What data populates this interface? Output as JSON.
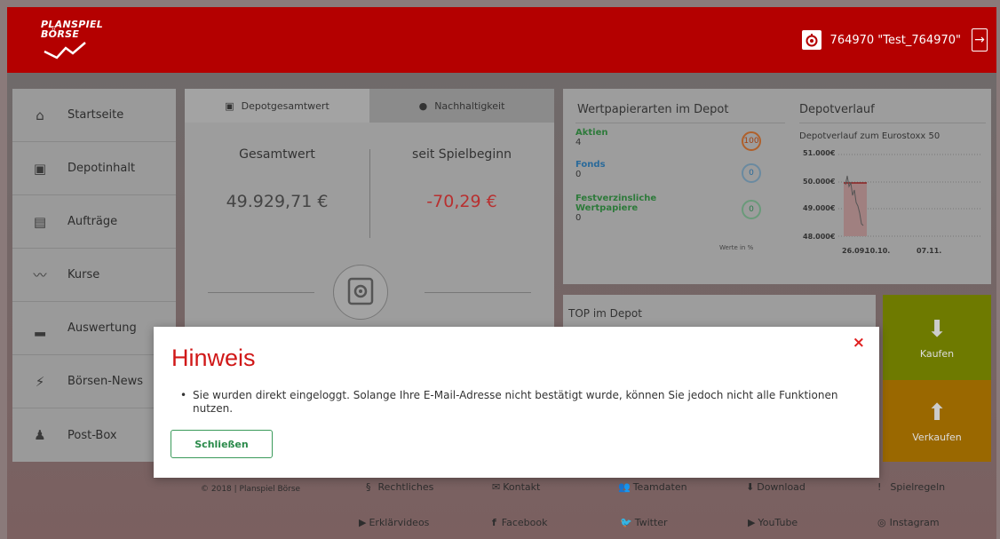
{
  "header": {
    "logo_line1": "PLANSPIEL",
    "logo_line2": "BÖRSE",
    "account": "764970 \"Test_764970\""
  },
  "sidebar": {
    "items": [
      {
        "label": "Startseite",
        "icon": "home-icon"
      },
      {
        "label": "Depotinhalt",
        "icon": "portfolio-icon"
      },
      {
        "label": "Aufträge",
        "icon": "orders-icon"
      },
      {
        "label": "Kurse",
        "icon": "prices-icon"
      },
      {
        "label": "Auswertung",
        "icon": "chart-icon"
      },
      {
        "label": "Börsen-News",
        "icon": "news-icon"
      },
      {
        "label": "Post-Box",
        "icon": "bell-icon"
      }
    ]
  },
  "depot": {
    "tab1": "Depotgesamtwert",
    "tab2": "Nachhaltigkeit",
    "col1_label": "Gesamtwert",
    "col1_value": "49.929,71 €",
    "col2_label": "seit Spielbeginn",
    "col2_value": "-70,29 €"
  },
  "wertpapiere": {
    "title": "Wertpapierarten im Depot",
    "rows": [
      {
        "name": "Aktien",
        "count": "4",
        "badge": "100"
      },
      {
        "name": "Fonds",
        "count": "0",
        "badge": "0"
      },
      {
        "name": "Festverzinsliche Wertpapiere",
        "count": "0",
        "badge": "0"
      }
    ],
    "note": "Werte in %"
  },
  "verlauf": {
    "title": "Depotverlauf",
    "subtitle": "Depotverlauf zum Eurostoxx 50",
    "y_ticks": [
      "51.000€",
      "50.000€",
      "49.000€",
      "48.000€"
    ],
    "x_ticks": [
      "26.09.",
      "10.10.",
      "07.11."
    ]
  },
  "top": {
    "title": "TOP im Depot"
  },
  "buttons": {
    "kaufen": "Kaufen",
    "verkaufen": "Verkaufen"
  },
  "footer": {
    "copyright": "© 2018 | Planspiel Börse",
    "rechtliches": "Rechtliches",
    "kontakt": "Kontakt",
    "teamdaten": "Teamdaten",
    "download": "Download",
    "spielregeln": "Spielregeln",
    "erklaervideos": "Erklärvideos",
    "facebook": "Facebook",
    "twitter": "Twitter",
    "youtube": "YouTube",
    "instagram": "Instagram"
  },
  "modal": {
    "title": "Hinweis",
    "message": "Sie wurden direkt eingeloggt. Solange Ihre E-Mail-Adresse nicht bestätigt wurde, können Sie jedoch nicht alle Funktionen nutzen.",
    "close_button": "Schließen",
    "close_x": "×"
  },
  "colors": {
    "brand_red": "#b40000",
    "modal_title": "#d01818",
    "button_green": "#3a9a5a"
  }
}
